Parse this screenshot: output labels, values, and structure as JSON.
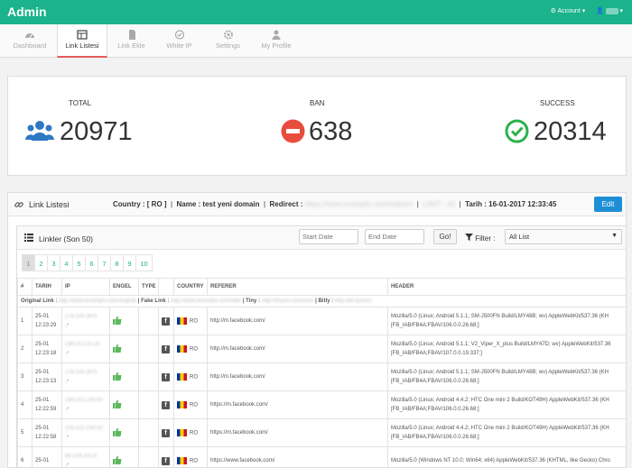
{
  "brand": "Admin",
  "topbar": {
    "account_label": "Account",
    "user_label": "user"
  },
  "tabs": [
    {
      "label": "Dashboard",
      "icon": "dashboard-icon"
    },
    {
      "label": "Link Listesi",
      "icon": "list-icon",
      "active": true
    },
    {
      "label": "Link Ekle",
      "icon": "file-icon"
    },
    {
      "label": "White IP",
      "icon": "check-circle-icon"
    },
    {
      "label": "Settings",
      "icon": "gear-icon"
    },
    {
      "label": "My Profile",
      "icon": "user-icon"
    }
  ],
  "stats": {
    "total": {
      "label": "TOTAL",
      "value": "20971",
      "color": "#2f78c4"
    },
    "ban": {
      "label": "BAN",
      "value": "638",
      "color": "#e84c3d"
    },
    "success": {
      "label": "SUCCESS",
      "value": "20314",
      "color": "#2bb24c"
    }
  },
  "panel": {
    "title": "Link Listesi",
    "country_label": "Country : [ RO ]",
    "name_label": "Name : test yeni domain",
    "redirect_label": "Redirect :",
    "redirect_value": "https://www.example.com/redirect",
    "limit_label": "LIMIT : 40",
    "date_label": "Tarih : 16-01-2017 12:33:45",
    "edit_button": "Edit"
  },
  "inner": {
    "title": "Linkler (Son 50)",
    "start_date_placeholder": "Start Date",
    "end_date_placeholder": "End Date",
    "go_button": "Go!",
    "filter_label": "Filter :",
    "filter_value": "All List"
  },
  "pages": [
    "1",
    "2",
    "3",
    "4",
    "5",
    "6",
    "7",
    "8",
    "9",
    "10"
  ],
  "table": {
    "headers": [
      "#",
      "TARIH",
      "IP",
      "ENGEL",
      "TYPE",
      "",
      "COUNTRY",
      "REFERER",
      "HEADER"
    ],
    "original_link": {
      "orig_label": "Original Link :",
      "orig_value": "http://www.example.com/original",
      "fake_label": "| Fake Link :",
      "fake_value": "http://www.example.com/fake",
      "tiny_label": "| Tiny :",
      "tiny_value": "http://tinyurl.com/xxxx",
      "bitly_label": "| Bitly :",
      "bitly_value": "http://bit.ly/xxxx"
    },
    "rows": [
      {
        "n": "1",
        "date": "25-01",
        "time": "12:23:29",
        "ip": "178.130.36.6",
        "country": "RO",
        "referer": "http://m.facebook.com/",
        "header1": "Mozilla/5.0 (Linux; Android 5.1.1; SM-J500FN Build/LMY48B; wv) AppleWebKit/537.36 (KH",
        "header2": "[FB_IAB/FB4A;FBAV/106.0.0.26.68;]"
      },
      {
        "n": "2",
        "date": "25-01",
        "time": "12:23:18",
        "ip": "188.25.120.16",
        "country": "RO",
        "referer": "http://m.facebook.com/",
        "header1": "Mozilla/5.0 (Linux; Android 5.1.1; V2_Viper_X_plus Build/LMY47D; wv) AppleWebKit/537.36",
        "header2": "[FB_IAB/FB4A;FBAV/107.0.0.19.337;]"
      },
      {
        "n": "3",
        "date": "25-01",
        "time": "12:23:13",
        "ip": "178.130.36.6",
        "country": "RO",
        "referer": "http://m.facebook.com/",
        "header1": "Mozilla/5.0 (Linux; Android 5.1.1; SM-J500FN Build/LMY48B; wv) AppleWebKit/537.36 (KH",
        "header2": "[FB_IAB/FB4A;FBAV/106.0.0.26.68;]"
      },
      {
        "n": "4",
        "date": "25-01",
        "time": "12:22:59",
        "ip": "109.102.156.50",
        "country": "RO",
        "referer": "https://m.facebook.com/",
        "header1": "Mozilla/5.0 (Linux; Android 4.4.2; HTC One mini 2 Build/KOT49H) AppleWebKit/537.36 (KH",
        "header2": "[FB_IAB/FB4A;FBAV/106.0.0.26.68;]"
      },
      {
        "n": "5",
        "date": "25-01",
        "time": "12:22:58",
        "ip": "109.102.156.50",
        "country": "RO",
        "referer": "https://m.facebook.com/",
        "header1": "Mozilla/5.0 (Linux; Android 4.4.2; HTC One mini 2 Build/KOT49H) AppleWebKit/537.36 (KH",
        "header2": "[FB_IAB/FB4A;FBAV/106.0.0.26.68;]"
      },
      {
        "n": "6",
        "date": "25-01",
        "time": "",
        "ip": "86.104.151.8",
        "country": "RO",
        "referer": "https://www.facebook.com/",
        "header1": "Mozilla/5.0 (Windows NT 10.0; Win64; x64) AppleWebKit/537.36 (KHTML, like Gecko) Chro",
        "header2": ""
      }
    ]
  }
}
